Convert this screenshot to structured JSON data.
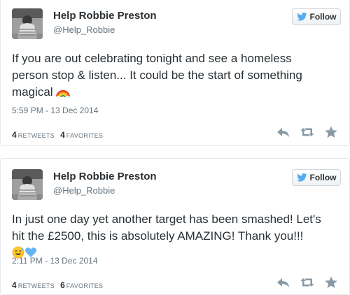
{
  "colors": {
    "text": "#292f33",
    "muted": "#66757f",
    "twitter_blue": "#55acee",
    "action_gray": "#8899a6",
    "border": "#e1e8ed"
  },
  "tweets": [
    {
      "author_name": "Help Robbie Preston",
      "author_handle": "@Help_Robbie",
      "follow_label": "Follow",
      "text_lines": [
        "If you are out celebrating tonight and see a homeless",
        "person stop & listen... It could be the start of something",
        "magical"
      ],
      "emoji": [
        "rainbow-emoji"
      ],
      "timestamp": "5:59 PM - 13 Dec 2014",
      "retweets_count": "4",
      "retweets_label": "RETWEETS",
      "favorites_count": "4",
      "favorites_label": "FAVORITES"
    },
    {
      "author_name": "Help Robbie Preston",
      "author_handle": "@Help_Robbie",
      "follow_label": "Follow",
      "text_lines": [
        "In just one day yet another target has been smashed! Let's",
        "hit the £2500, this is absolutely AMAZING! Thank you!!!"
      ],
      "emoji": [
        "sweat-smile-emoji",
        "blue-heart-emoji"
      ],
      "timestamp": "2:11 PM - 13 Dec 2014",
      "retweets_count": "4",
      "retweets_label": "RETWEETS",
      "favorites_count": "6",
      "favorites_label": "FAVORITES"
    }
  ],
  "icons": {
    "follow": "twitter-bird-icon",
    "reply": "reply-icon",
    "retweet": "retweet-icon",
    "favorite": "star-icon"
  }
}
